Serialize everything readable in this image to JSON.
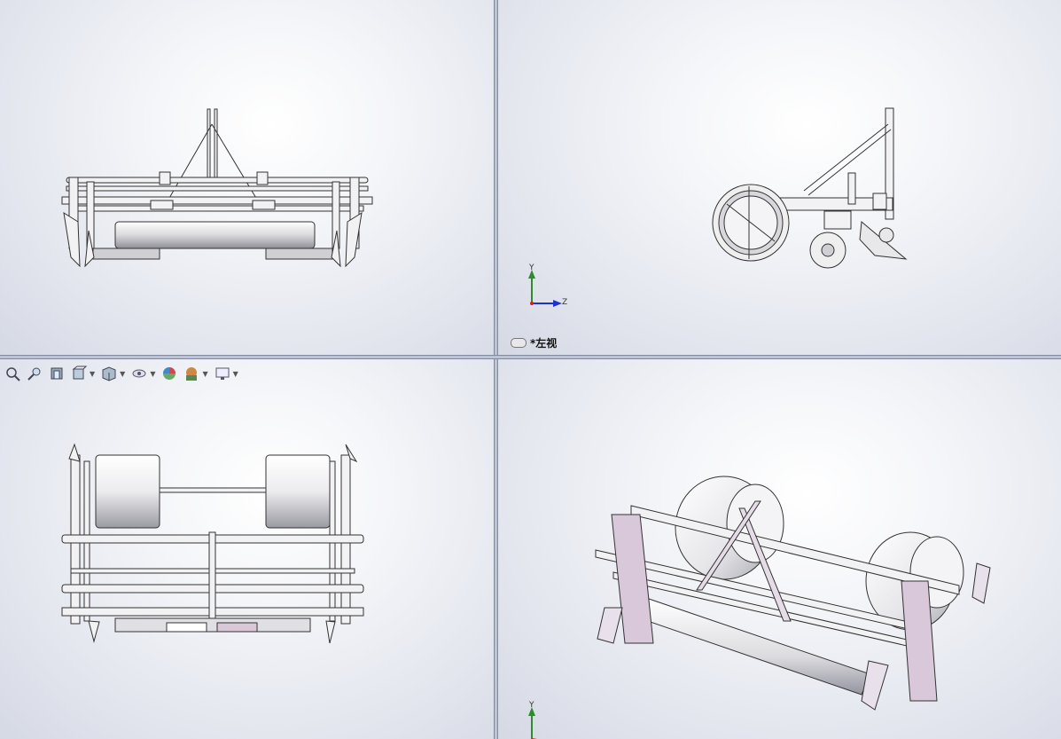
{
  "window": {
    "layout": "four-viewport"
  },
  "viewports": {
    "top_left": {
      "label": ""
    },
    "top_right": {
      "label": "*左视",
      "triad": {
        "axis_y": "Y",
        "axis_z": "Z"
      }
    },
    "bottom_left": {
      "label": ""
    },
    "bottom_right": {
      "label": "",
      "triad": {
        "axis_y": "Y"
      }
    }
  },
  "heads_up_toolbar": {
    "items": [
      {
        "icon": "zoom-to-fit-icon"
      },
      {
        "icon": "zoom-to-area-icon"
      },
      {
        "icon": "previous-view-icon"
      },
      {
        "icon": "section-view-icon",
        "has_dropdown": true
      },
      {
        "icon": "view-orientation-icon",
        "has_dropdown": true
      },
      {
        "icon": "display-style-icon",
        "has_dropdown": true
      },
      {
        "icon": "hide-show-items-icon"
      },
      {
        "icon": "edit-appearance-icon",
        "has_dropdown": true
      },
      {
        "icon": "apply-scene-icon",
        "has_dropdown": true
      }
    ]
  },
  "colors": {
    "axis_y": "#2e8b2e",
    "axis_z": "#2233cc",
    "axis_x": "#cc2222",
    "part_metal": "#f0f0f2",
    "part_edge": "#333333",
    "part_shade": "#b8a8bc"
  }
}
